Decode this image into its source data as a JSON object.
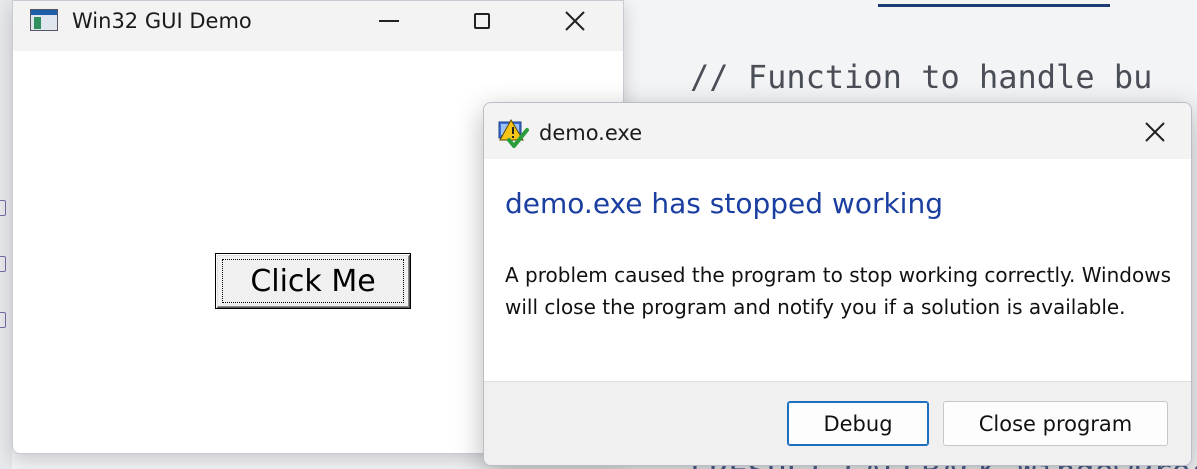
{
  "background_editor": {
    "comment_line": "// Function to handle bu",
    "bottom_line": "LRESULT CALLBACK WindowProc"
  },
  "main_window": {
    "title": "Win32 GUI Demo",
    "icon": "application-window-icon",
    "controls": [
      "minimize-icon",
      "maximize-icon",
      "close-icon"
    ],
    "button_label": "Click Me"
  },
  "error_dialog": {
    "title": "demo.exe",
    "icon": "warning-shield-icon",
    "heading": "demo.exe has stopped working",
    "message": "A problem caused the program to stop working correctly. Windows will close the program and notify you if a solution is available.",
    "buttons": {
      "debug": "Debug",
      "close_program": "Close program"
    },
    "heading_color": "#1a3fa0"
  }
}
